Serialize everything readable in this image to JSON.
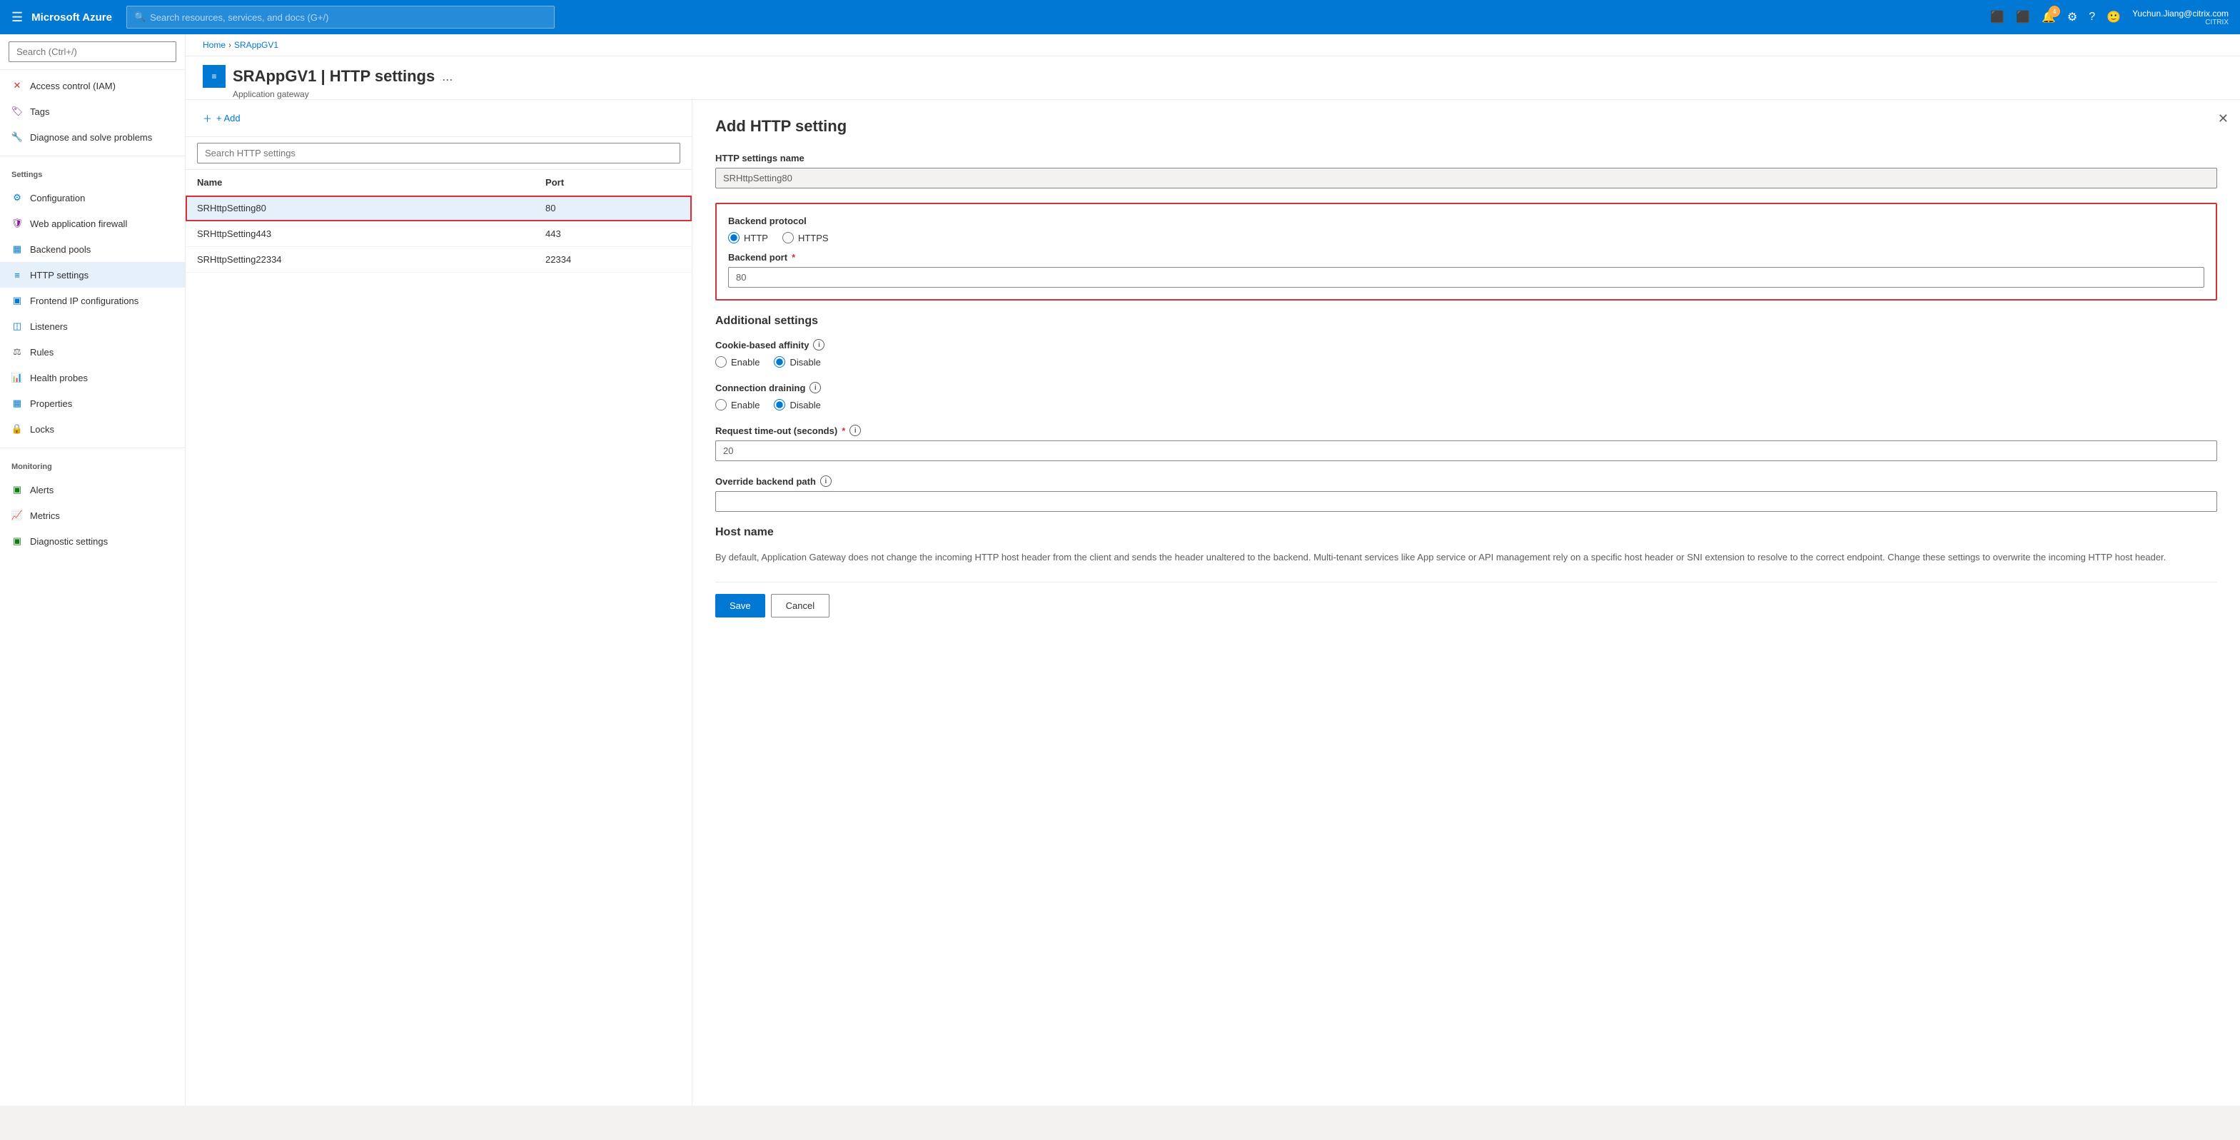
{
  "topnav": {
    "hamburger": "☰",
    "brand": "Microsoft Azure",
    "search_placeholder": "Search resources, services, and docs (G+/)",
    "notification_count": "4",
    "user_name": "Yuchun.Jiang@citrix.com",
    "user_company": "CITRIX"
  },
  "breadcrumb": {
    "home": "Home",
    "resource": "SRAppGV1"
  },
  "page_header": {
    "title": "SRAppGV1 | HTTP settings",
    "subtitle": "Application gateway",
    "more_icon": "..."
  },
  "sidebar": {
    "search_placeholder": "Search (Ctrl+/)",
    "items": [
      {
        "id": "access-control",
        "label": "Access control (IAM)",
        "icon": "×",
        "icon_type": "access"
      },
      {
        "id": "tags",
        "label": "Tags",
        "icon": "◇",
        "icon_type": "tags"
      },
      {
        "id": "diagnose",
        "label": "Diagnose and solve problems",
        "icon": "🔧",
        "icon_type": "diagnose"
      }
    ],
    "sections": [
      {
        "title": "Settings",
        "items": [
          {
            "id": "configuration",
            "label": "Configuration",
            "icon": "⚙",
            "icon_type": "config"
          },
          {
            "id": "waf",
            "label": "Web application firewall",
            "icon": "🛡",
            "icon_type": "waf"
          },
          {
            "id": "backend-pools",
            "label": "Backend pools",
            "icon": "▦",
            "icon_type": "backend"
          },
          {
            "id": "http-settings",
            "label": "HTTP settings",
            "icon": "≡",
            "icon_type": "http",
            "active": true
          },
          {
            "id": "frontend-ip",
            "label": "Frontend IP configurations",
            "icon": "▣",
            "icon_type": "frontend"
          },
          {
            "id": "listeners",
            "label": "Listeners",
            "icon": "◫",
            "icon_type": "listeners"
          },
          {
            "id": "rules",
            "label": "Rules",
            "icon": "⚖",
            "icon_type": "rules"
          },
          {
            "id": "health-probes",
            "label": "Health probes",
            "icon": "📊",
            "icon_type": "health"
          },
          {
            "id": "properties",
            "label": "Properties",
            "icon": "▦",
            "icon_type": "props"
          },
          {
            "id": "locks",
            "label": "Locks",
            "icon": "🔒",
            "icon_type": "locks"
          }
        ]
      },
      {
        "title": "Monitoring",
        "items": [
          {
            "id": "alerts",
            "label": "Alerts",
            "icon": "▣",
            "icon_type": "alerts"
          },
          {
            "id": "metrics",
            "label": "Metrics",
            "icon": "📈",
            "icon_type": "metrics"
          },
          {
            "id": "diagnostic",
            "label": "Diagnostic settings",
            "icon": "▣",
            "icon_type": "diag"
          }
        ]
      }
    ]
  },
  "table": {
    "add_label": "+ Add",
    "search_placeholder": "Search HTTP settings",
    "columns": [
      {
        "key": "name",
        "label": "Name"
      },
      {
        "key": "port",
        "label": "Port"
      }
    ],
    "rows": [
      {
        "name": "SRHttpSetting80",
        "port": "80",
        "selected": true
      },
      {
        "name": "SRHttpSetting443",
        "port": "443",
        "selected": false
      },
      {
        "name": "SRHttpSetting22334",
        "port": "22334",
        "selected": false
      }
    ]
  },
  "form": {
    "title": "Add HTTP setting",
    "close_icon": "✕",
    "http_settings_name_label": "HTTP settings name",
    "http_settings_name_value": "SRHttpSetting80",
    "backend_protocol_label": "Backend protocol",
    "protocol_options": [
      {
        "value": "HTTP",
        "label": "HTTP",
        "selected": true
      },
      {
        "value": "HTTPS",
        "label": "HTTPS",
        "selected": false
      }
    ],
    "backend_port_label": "Backend port",
    "backend_port_required": "*",
    "backend_port_value": "80",
    "additional_settings_title": "Additional settings",
    "cookie_affinity_label": "Cookie-based affinity",
    "cookie_options": [
      {
        "value": "enable",
        "label": "Enable",
        "selected": false
      },
      {
        "value": "disable",
        "label": "Disable",
        "selected": true
      }
    ],
    "connection_draining_label": "Connection draining",
    "draining_options": [
      {
        "value": "enable",
        "label": "Enable",
        "selected": false
      },
      {
        "value": "disable",
        "label": "Disable",
        "selected": true
      }
    ],
    "request_timeout_label": "Request time-out (seconds)",
    "request_timeout_required": "*",
    "request_timeout_value": "20",
    "override_path_label": "Override backend path",
    "override_path_value": "",
    "host_name_title": "Host name",
    "host_name_desc": "By default, Application Gateway does not change the incoming HTTP host header from the client and sends the header unaltered to the backend. Multi-tenant services like App service or API management rely on a specific host header or SNI extension to resolve to the correct endpoint. Change these settings to overwrite the incoming HTTP host header.",
    "save_label": "Save",
    "cancel_label": "Cancel"
  }
}
